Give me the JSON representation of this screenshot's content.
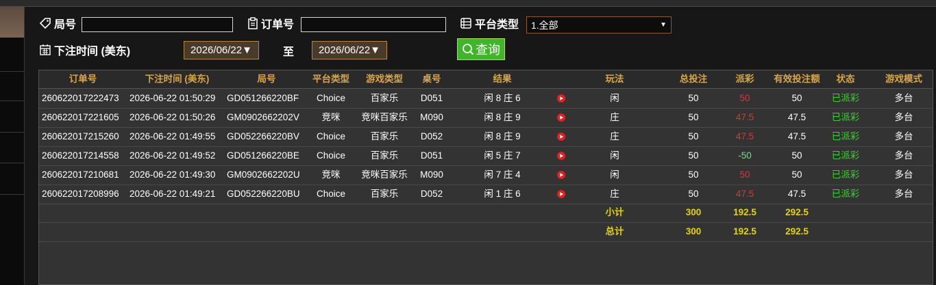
{
  "filters": {
    "ju_hao_label": "局号",
    "ju_hao_value": "",
    "order_label": "订单号",
    "order_value": "",
    "platform_label": "平台类型",
    "platform_value": "1.全部",
    "bet_time_label": "下注时间 (美东)",
    "date_from": "2026/06/22▼",
    "to_label": "至",
    "date_to": "2026/06/22▼",
    "query_label": "查询"
  },
  "table": {
    "headers": [
      "订单号",
      "下注时间 (美东)",
      "局号",
      "平台类型",
      "游戏类型",
      "桌号",
      "结果",
      "玩法",
      "总投注",
      "派彩",
      "有效投注额",
      "状态",
      "游戏模式"
    ],
    "rows": [
      [
        "260622017222473",
        "2026-06-22 01:50:29",
        "GD051266220BF",
        "Choice",
        "百家乐",
        "D051",
        "闲 8 庄 6",
        "闲",
        "50",
        "50",
        "50",
        "已派彩",
        "多台"
      ],
      [
        "260622017221605",
        "2026-06-22 01:50:26",
        "GM0902662202V",
        "竞咪",
        "竞咪百家乐",
        "M090",
        "闲 8 庄 9",
        "庄",
        "50",
        "47.5",
        "47.5",
        "已派彩",
        "多台"
      ],
      [
        "260622017215260",
        "2026-06-22 01:49:55",
        "GD052266220BV",
        "Choice",
        "百家乐",
        "D052",
        "闲 8 庄 9",
        "庄",
        "50",
        "47.5",
        "47.5",
        "已派彩",
        "多台"
      ],
      [
        "260622017214558",
        "2026-06-22 01:49:52",
        "GD051266220BE",
        "Choice",
        "百家乐",
        "D051",
        "闲 5 庄 7",
        "闲",
        "50",
        "-50",
        "50",
        "已派彩",
        "多台"
      ],
      [
        "260622017210681",
        "2026-06-22 01:49:30",
        "GM0902662202U",
        "竞咪",
        "竞咪百家乐",
        "M090",
        "闲 7 庄 4",
        "闲",
        "50",
        "50",
        "50",
        "已派彩",
        "多台"
      ],
      [
        "260622017208996",
        "2026-06-22 01:49:21",
        "GD052266220BU",
        "Choice",
        "百家乐",
        "D052",
        "闲 1 庄 6",
        "庄",
        "50",
        "47.5",
        "47.5",
        "已派彩",
        "多台"
      ]
    ],
    "subtotal": {
      "label": "小计",
      "total_bet": "300",
      "payout": "192.5",
      "valid_bet": "292.5"
    },
    "total": {
      "label": "总计",
      "total_bet": "300",
      "payout": "192.5",
      "valid_bet": "292.5"
    }
  },
  "colors": {
    "header_text": "#d9a547",
    "payout_red": "#d23a3a",
    "payout_green": "#39d32c",
    "status_green": "#39d32c",
    "summary_yellow": "#e6d200",
    "query_button": "#3fb62a"
  },
  "icons": [
    "tag-icon",
    "clipboard-icon",
    "list-icon",
    "calendar-icon",
    "search-icon",
    "video-play-icon"
  ]
}
